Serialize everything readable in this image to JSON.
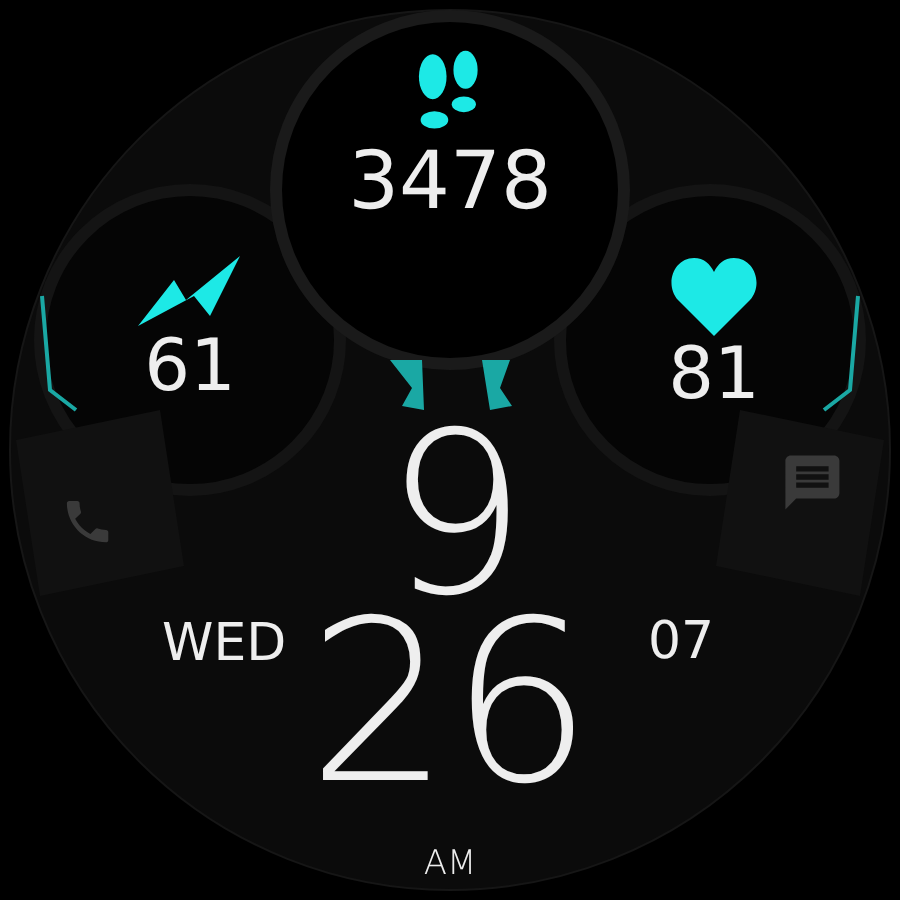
{
  "complications": [
    {
      "kind": "steps",
      "value": "3478"
    },
    {
      "kind": "energy",
      "value": "61"
    },
    {
      "kind": "heart_rate",
      "value": "81"
    }
  ],
  "shortcuts": [
    {
      "kind": "phone"
    },
    {
      "kind": "message"
    }
  ],
  "time": {
    "hour": "9",
    "minute": "26",
    "period": "AM"
  },
  "date": {
    "weekday": "WED",
    "day": "07"
  }
}
